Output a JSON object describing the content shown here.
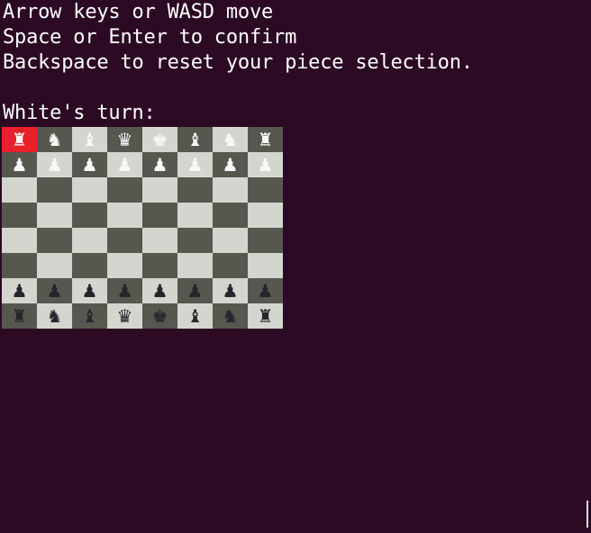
{
  "instructions": [
    "Arrow keys or WASD move",
    "Space or Enter to confirm",
    "Backspace to reset your piece selection."
  ],
  "turn_text": "White's turn:",
  "cursor": {
    "row": 0,
    "col": 0
  },
  "colors": {
    "background": "#2c0a23",
    "light_square": "#d3d6cf",
    "dark_square": "#565850",
    "cursor": "#e8202a",
    "white_piece": "#f7f7f7",
    "black_piece": "#24262a"
  },
  "board": [
    [
      {
        "p": "♜",
        "c": "white"
      },
      {
        "p": "♞",
        "c": "white"
      },
      {
        "p": "♝",
        "c": "white"
      },
      {
        "p": "♛",
        "c": "white"
      },
      {
        "p": "♚",
        "c": "white"
      },
      {
        "p": "♝",
        "c": "white"
      },
      {
        "p": "♞",
        "c": "white"
      },
      {
        "p": "♜",
        "c": "white"
      }
    ],
    [
      {
        "p": "♟",
        "c": "white"
      },
      {
        "p": "♟",
        "c": "white"
      },
      {
        "p": "♟",
        "c": "white"
      },
      {
        "p": "♟",
        "c": "white"
      },
      {
        "p": "♟",
        "c": "white"
      },
      {
        "p": "♟",
        "c": "white"
      },
      {
        "p": "♟",
        "c": "white"
      },
      {
        "p": "♟",
        "c": "white"
      }
    ],
    [
      null,
      null,
      null,
      null,
      null,
      null,
      null,
      null
    ],
    [
      null,
      null,
      null,
      null,
      null,
      null,
      null,
      null
    ],
    [
      null,
      null,
      null,
      null,
      null,
      null,
      null,
      null
    ],
    [
      null,
      null,
      null,
      null,
      null,
      null,
      null,
      null
    ],
    [
      {
        "p": "♟",
        "c": "black"
      },
      {
        "p": "♟",
        "c": "black"
      },
      {
        "p": "♟",
        "c": "black"
      },
      {
        "p": "♟",
        "c": "black"
      },
      {
        "p": "♟",
        "c": "black"
      },
      {
        "p": "♟",
        "c": "black"
      },
      {
        "p": "♟",
        "c": "black"
      },
      {
        "p": "♟",
        "c": "black"
      }
    ],
    [
      {
        "p": "♜",
        "c": "black"
      },
      {
        "p": "♞",
        "c": "black"
      },
      {
        "p": "♝",
        "c": "black"
      },
      {
        "p": "♛",
        "c": "black"
      },
      {
        "p": "♚",
        "c": "black"
      },
      {
        "p": "♝",
        "c": "black"
      },
      {
        "p": "♞",
        "c": "black"
      },
      {
        "p": "♜",
        "c": "black"
      }
    ]
  ]
}
